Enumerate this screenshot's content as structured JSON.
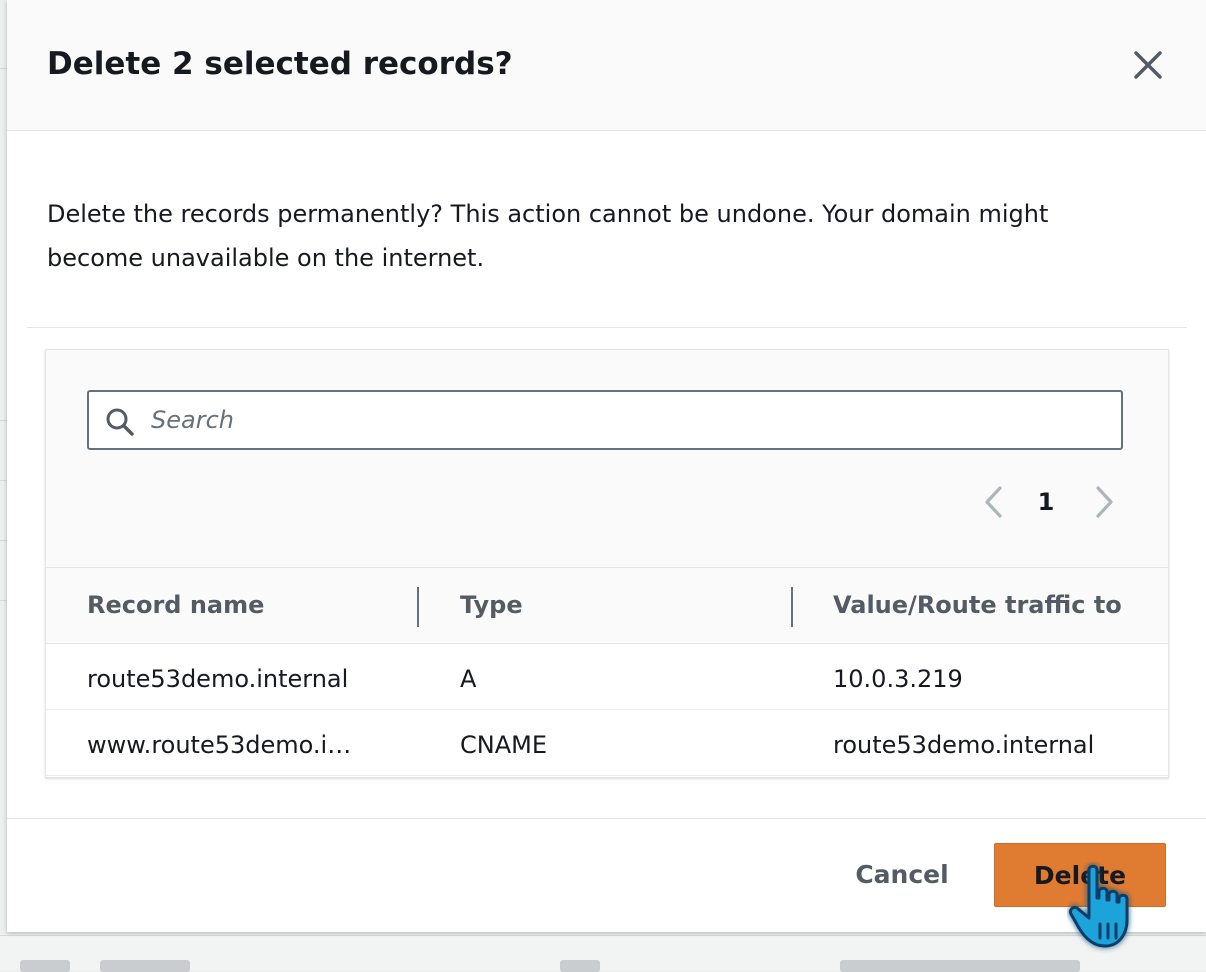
{
  "dialog": {
    "title": "Delete 2 selected records?",
    "message": "Delete the records permanently? This action cannot be undone. Your domain might become unavailable on the internet."
  },
  "table": {
    "search": {
      "placeholder": "Search",
      "value": ""
    },
    "pagination": {
      "current_page": "1"
    },
    "columns": [
      "Record name",
      "Type",
      "Value/Route traffic to"
    ],
    "rows": [
      [
        "route53demo.internal",
        "A",
        "10.0.3.219"
      ],
      [
        "www.route53demo.i…",
        "CNAME",
        "route53demo.internal"
      ]
    ]
  },
  "footer": {
    "cancel_label": "Cancel",
    "delete_label": "Delete"
  },
  "colors": {
    "primary_button": "#e07b32",
    "text": "#16191f",
    "muted_text": "#545b64",
    "header_bg": "#fafafa"
  },
  "icons": {
    "close": "close-icon",
    "search": "search-icon",
    "prev": "chevron-left-icon",
    "next": "chevron-right-icon",
    "cursor": "pointer-hand-icon"
  }
}
